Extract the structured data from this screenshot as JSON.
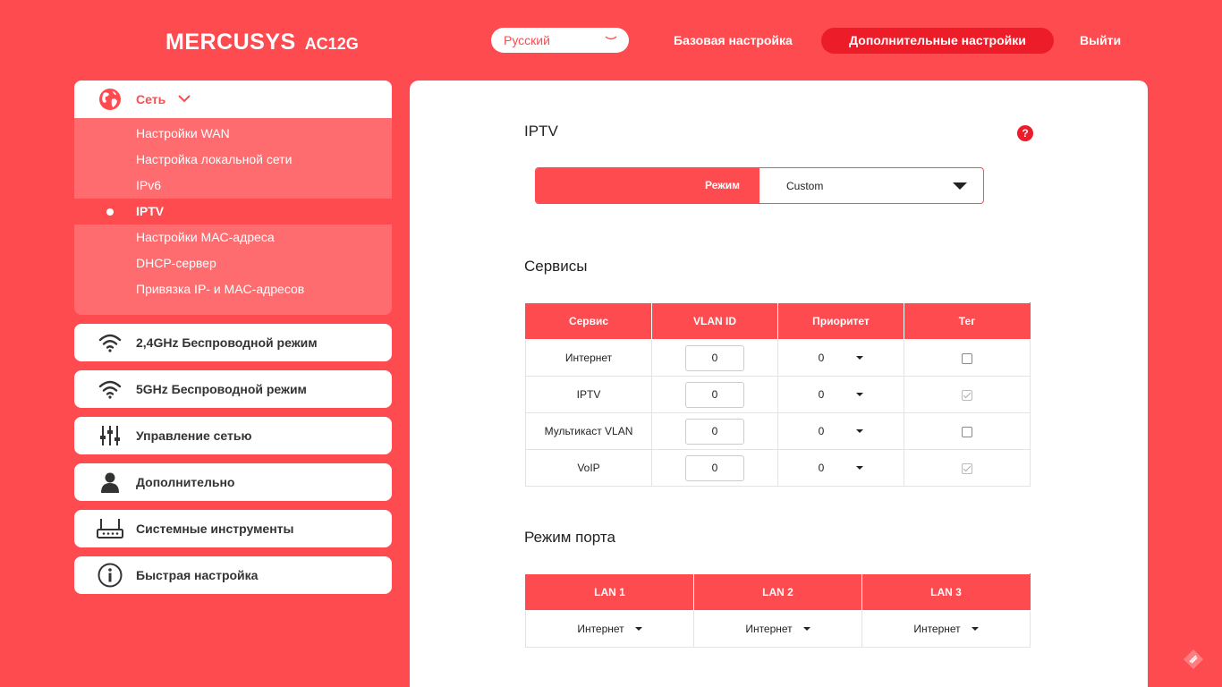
{
  "header": {
    "brand": "MERCUSYS",
    "model": "AC12G",
    "language": "Русский",
    "nav_basic": "Базовая настройка",
    "nav_advanced": "Дополнительные настройки",
    "nav_exit": "Выйти"
  },
  "sidebar": {
    "network": {
      "label": "Сеть",
      "icon": "globe-icon",
      "items": [
        {
          "label": "Настройки WAN"
        },
        {
          "label": "Настройка локальной сети"
        },
        {
          "label": "IPv6"
        },
        {
          "label": "IPTV"
        },
        {
          "label": "Настройки MAC-адреса"
        },
        {
          "label": "DHCP-сервер"
        },
        {
          "label": "Привязка IP- и MAC-адресов"
        }
      ],
      "active_item": "IPTV"
    },
    "sections": [
      {
        "label": "2,4GHz Беспроводной режим",
        "icon": "wifi-icon"
      },
      {
        "label": "5GHz Беспроводной режим",
        "icon": "wifi-icon"
      },
      {
        "label": "Управление сетью",
        "icon": "sliders-icon"
      },
      {
        "label": "Дополнительно",
        "icon": "user-icon"
      },
      {
        "label": "Системные инструменты",
        "icon": "router-icon"
      },
      {
        "label": "Быстрая настройка",
        "icon": "info-icon"
      }
    ]
  },
  "main": {
    "iptv_title": "IPTV",
    "help_label": "?",
    "mode_label": "Режим",
    "mode_value": "Custom",
    "services_title": "Сервисы",
    "services_headers": [
      "Сервис",
      "VLAN ID",
      "Приоритет",
      "Тег"
    ],
    "services": [
      {
        "name": "Интернет",
        "vlan_id": "0",
        "priority": "0",
        "tag": false
      },
      {
        "name": "IPTV",
        "vlan_id": "0",
        "priority": "0",
        "tag": true
      },
      {
        "name": "Мультикаст VLAN",
        "vlan_id": "0",
        "priority": "0",
        "tag": false
      },
      {
        "name": "VoIP",
        "vlan_id": "0",
        "priority": "0",
        "tag": true
      }
    ],
    "port_mode_title": "Режим порта",
    "port_headers": [
      "LAN 1",
      "LAN 2",
      "LAN 3"
    ],
    "port_values": [
      "Интернет",
      "Интернет",
      "Интернет"
    ]
  },
  "colors": {
    "brand_red": "#fd4b50",
    "active_red": "#ec1c28",
    "submenu_bg": "#fe6c6f"
  }
}
